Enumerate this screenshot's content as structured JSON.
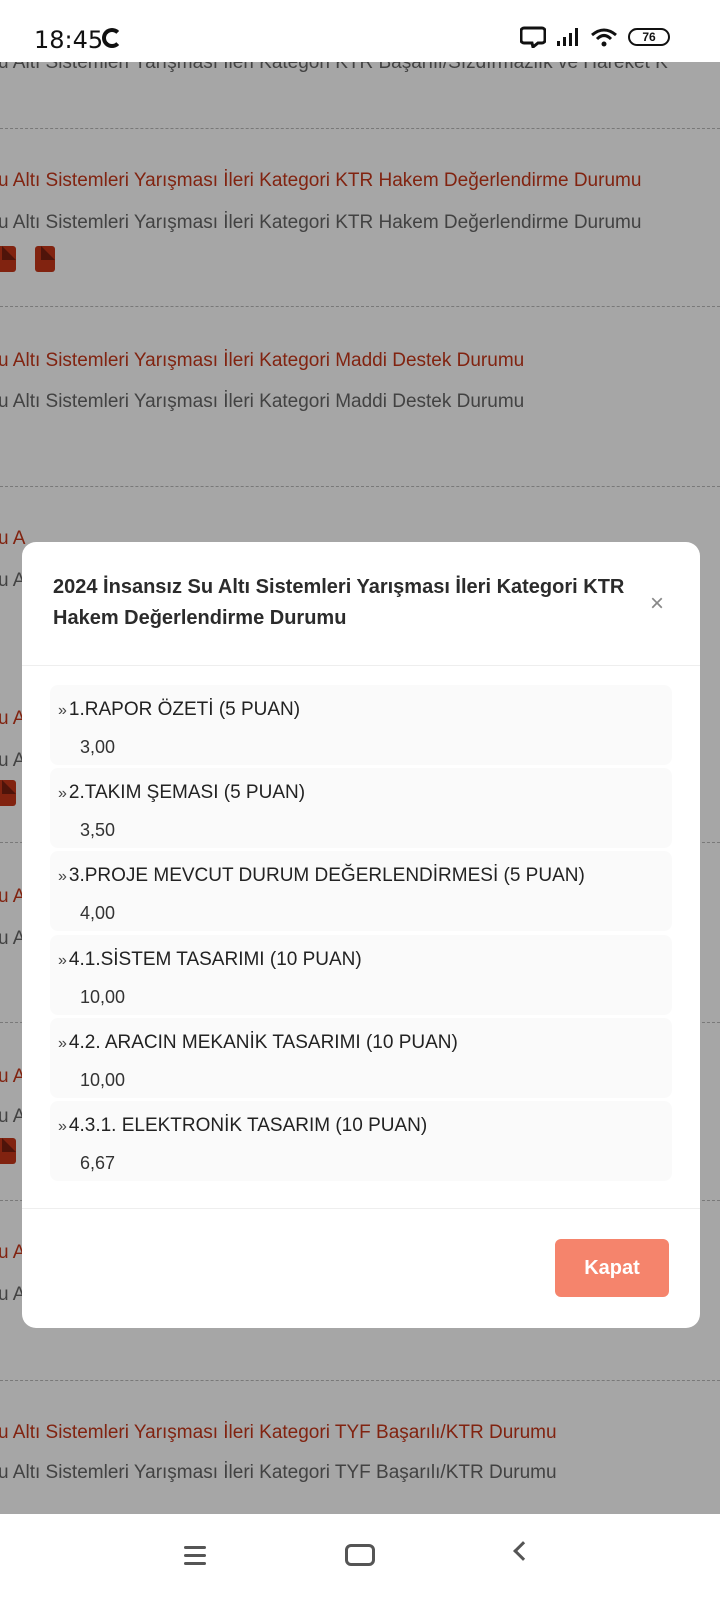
{
  "status": {
    "time": "18:45",
    "battery": "76"
  },
  "background": {
    "items": [
      {
        "title": "",
        "sub": "u Altı Sistemleri Yarışması İleri Kategori KTR Başarılı/Sızdırmazlık ve Hareket K"
      },
      {
        "title": "u Altı Sistemleri Yarışması İleri Kategori KTR Hakem Değerlendirme Durumu",
        "sub": "u Altı Sistemleri Yarışması İleri Kategori KTR Hakem Değerlendirme Durumu"
      },
      {
        "title": "u Altı Sistemleri Yarışması İleri Kategori Maddi Destek Durumu",
        "sub": "u Altı Sistemleri Yarışması İleri Kategori Maddi Destek Durumu"
      },
      {
        "title": "u Altı Sistemleri Yarışması İleri Kategori TYF Başarılı/KTR Durumu",
        "sub": "u Altı Sistemleri Yarışması İleri Kategori TYF Başarılı/KTR Durumu"
      }
    ],
    "fragment_a": "u A",
    "fragment_l": "u"
  },
  "modal": {
    "title": "2024 İnsansız Su Altı Sistemleri Yarışması İleri Kategori KTR Hakem Değerlendirme Durumu",
    "close_icon": "×",
    "items": [
      {
        "label": "1.RAPOR ÖZETİ (5 PUAN)",
        "value": "3,00"
      },
      {
        "label": "2.TAKIM ŞEMASI (5 PUAN)",
        "value": "3,50"
      },
      {
        "label": "3.PROJE MEVCUT DURUM DEĞERLENDİRMESİ (5 PUAN)",
        "value": "4,00"
      },
      {
        "label": "4.1.SİSTEM TASARIMI (10 PUAN)",
        "value": "10,00"
      },
      {
        "label": "4.2. ARACIN MEKANİK TASARIMI (10 PUAN)",
        "value": "10,00"
      },
      {
        "label": "4.3.1. ELEKTRONİK TASARIM (10 PUAN)",
        "value": "6,67"
      }
    ],
    "button": "Kapat"
  },
  "colors": {
    "accent": "#c6371a",
    "button": "#f5846c"
  }
}
